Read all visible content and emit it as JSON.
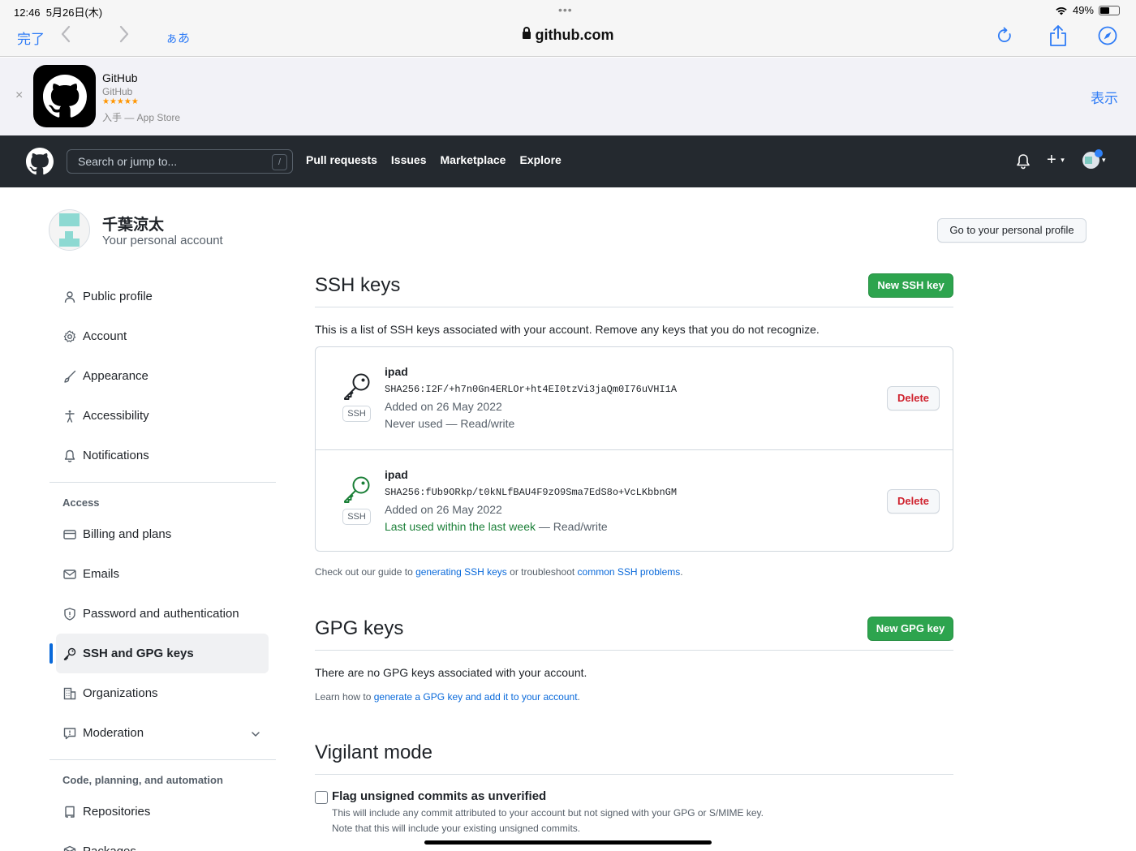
{
  "status_bar": {
    "time": "12:46",
    "date": "5月26日(木)",
    "dots": "•••",
    "battery_text": "49%",
    "battery_level": 0.49
  },
  "safari": {
    "done_label": "完了",
    "aa_label": "ぁあ",
    "url": "github.com"
  },
  "app_banner": {
    "close": "×",
    "name": "GitHub",
    "developer": "GitHub",
    "stars": "★★★★★",
    "store": "入手 — App Store",
    "view_label": "表示"
  },
  "gh_header": {
    "search_placeholder": "Search or jump to...",
    "search_shortcut": "/",
    "nav": [
      "Pull requests",
      "Issues",
      "Marketplace",
      "Explore"
    ],
    "plus": "+",
    "caret": "▾"
  },
  "account": {
    "name": "千葉涼太",
    "subtitle": "Your personal account",
    "profile_button": "Go to your personal profile"
  },
  "sidebar": {
    "items": [
      {
        "label": "Public profile",
        "icon": "person-icon"
      },
      {
        "label": "Account",
        "icon": "gear-icon"
      },
      {
        "label": "Appearance",
        "icon": "paintbrush-icon"
      },
      {
        "label": "Accessibility",
        "icon": "accessibility-icon"
      },
      {
        "label": "Notifications",
        "icon": "bell-icon"
      }
    ],
    "access_heading": "Access",
    "access_items": [
      {
        "label": "Billing and plans",
        "icon": "credit-card-icon"
      },
      {
        "label": "Emails",
        "icon": "mail-icon"
      },
      {
        "label": "Password and authentication",
        "icon": "shield-icon"
      },
      {
        "label": "SSH and GPG keys",
        "icon": "key-icon"
      },
      {
        "label": "Organizations",
        "icon": "organization-icon"
      },
      {
        "label": "Moderation",
        "icon": "report-icon"
      }
    ],
    "code_heading": "Code, planning, and automation",
    "code_items": [
      {
        "label": "Repositories",
        "icon": "repo-icon"
      },
      {
        "label": "Packages",
        "icon": "package-icon"
      }
    ]
  },
  "ssh": {
    "title": "SSH keys",
    "new_button": "New SSH key",
    "intro": "This is a list of SSH keys associated with your account. Remove any keys that you do not recognize.",
    "keys": [
      {
        "title": "ipad",
        "badge": "SSH",
        "fingerprint": "SHA256:I2F/+h7n0Gn4ERLOr+ht4EI0tzVi3jaQm0I76uVHI1A",
        "added": "Added on 26 May 2022",
        "usage_prefix": "Never used",
        "usage_suffix": " — Read/write",
        "delete_label": "Delete",
        "icon_color": "#1f2328"
      },
      {
        "title": "ipad",
        "badge": "SSH",
        "fingerprint": "SHA256:fUb9ORkp/t0kNLfBAU4F9zO9Sma7EdS8o+VcLKbbnGM",
        "added": "Added on 26 May 2022",
        "usage_prefix": "Last used within the last week",
        "usage_suffix": " — Read/write",
        "delete_label": "Delete",
        "icon_color": "#1a7f37"
      }
    ],
    "guide_prefix": "Check out our guide to ",
    "guide_link1": "generating SSH keys",
    "guide_mid": " or troubleshoot ",
    "guide_link2": "common SSH problems",
    "guide_suffix": "."
  },
  "gpg": {
    "title": "GPG keys",
    "new_button": "New GPG key",
    "empty": "There are no GPG keys associated with your account.",
    "learn_prefix": "Learn how to ",
    "learn_link": "generate a GPG key and add it to your account",
    "learn_suffix": "."
  },
  "vigilant": {
    "title": "Vigilant mode",
    "checkbox_label": "Flag unsigned commits as unverified",
    "checked": false,
    "note1": "This will include any commit attributed to your account but not signed with your GPG or S/MIME key.",
    "note2": "Note that this will include your existing unsigned commits."
  },
  "colors": {
    "header_bg": "#24292f",
    "primary_green": "#2da44e",
    "link_blue": "#0969da",
    "danger": "#cf222e",
    "ios_blue": "#2f7cf6"
  }
}
